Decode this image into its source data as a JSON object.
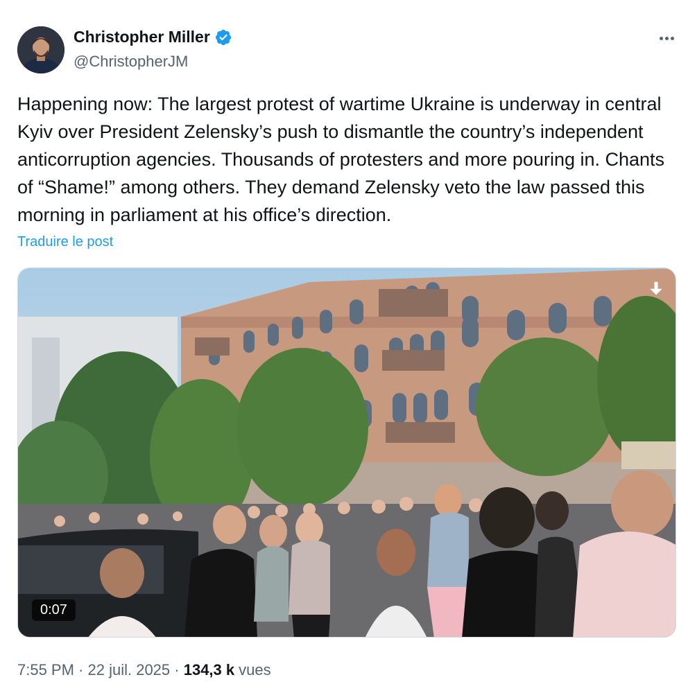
{
  "author": {
    "name": "Christopher Miller",
    "handle": "@ChristopherJM",
    "verified": true,
    "verified_color": "#1d9bf0"
  },
  "tweet": {
    "text": "Happening now: The largest protest of wartime Ukraine is underway in central Kyiv over President Zelensky’s push to dismantle the country’s independent anticorruption agencies. Thousands of protesters and more pouring in. Chants of “Shame!” among others. They demand Zelensky veto the law passed this morning in parliament at his office’s direction.",
    "translate_label": "Traduire le post"
  },
  "media": {
    "duration": "0:07"
  },
  "meta": {
    "time": "7:55 PM",
    "separator": " · ",
    "date": "22 juil. 2025",
    "views_count": "134,3 k",
    "views_label": "vues"
  },
  "icons": {
    "verified": "verified-badge-icon",
    "more": "more-horizontal-icon",
    "download": "download-arrow-icon"
  },
  "colors": {
    "link": "#1d9bf0",
    "secondary_text": "#536471",
    "primary_text": "#0f1419"
  }
}
